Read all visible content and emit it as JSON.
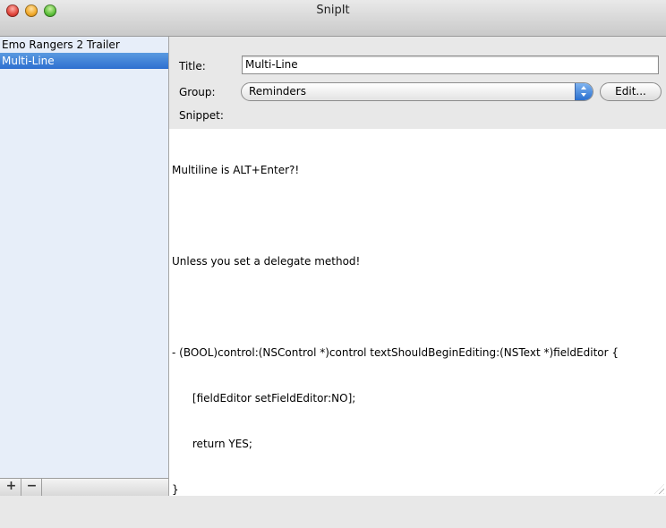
{
  "window": {
    "title": "SnipIt"
  },
  "sidebar": {
    "items": [
      {
        "label": "Emo Rangers 2 Trailer",
        "selected": false
      },
      {
        "label": "Multi-Line",
        "selected": true
      }
    ],
    "add_label": "+",
    "remove_label": "−"
  },
  "form": {
    "title_label": "Title:",
    "title_value": "Multi-Line",
    "group_label": "Group:",
    "group_value": "Reminders",
    "edit_label": "Edit...",
    "snippet_label": "Snippet:"
  },
  "snippet": {
    "lines": [
      "Multiline is ALT+Enter?!",
      "",
      "Unless you set a delegate method!",
      "",
      "- (BOOL)control:(NSControl *)control textShouldBeginEditing:(NSText *)fieldEditor {",
      "      [fieldEditor setFieldEditor:NO];",
      "      return YES;",
      "}"
    ]
  },
  "icons": {
    "close": "close-button-icon",
    "minimize": "minimize-button-icon",
    "zoom": "zoom-button-icon",
    "select_arrows": "select-arrows-icon",
    "resize": "resize-grip-icon"
  },
  "colors": {
    "selection": "#2e6fd0",
    "sidebar_background": "#e7eef9"
  }
}
